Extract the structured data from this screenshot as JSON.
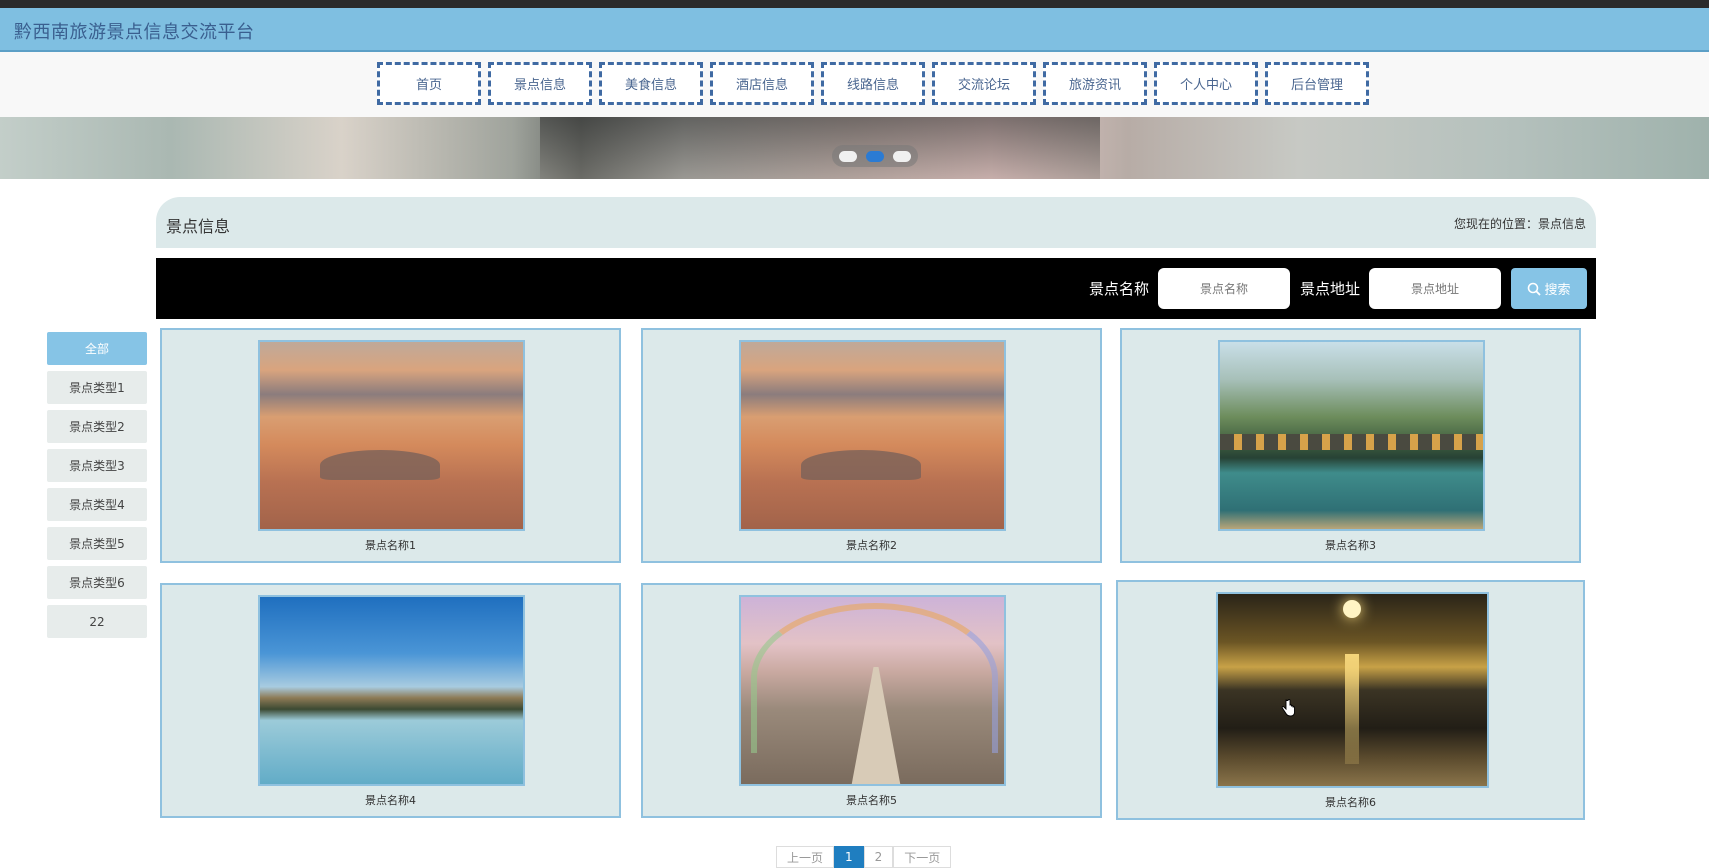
{
  "site": {
    "title": "黔西南旅游景点信息交流平台"
  },
  "nav": [
    {
      "label": "首页"
    },
    {
      "label": "景点信息"
    },
    {
      "label": "美食信息"
    },
    {
      "label": "酒店信息"
    },
    {
      "label": "线路信息"
    },
    {
      "label": "交流论坛"
    },
    {
      "label": "旅游资讯"
    },
    {
      "label": "个人中心"
    },
    {
      "label": "后台管理"
    }
  ],
  "banner": {
    "dot_count": 3,
    "active_dot": 2
  },
  "breadcrumb": {
    "title": "景点信息",
    "location_prefix": "您现在的位置：",
    "location_current": "景点信息"
  },
  "search": {
    "name_label": "景点名称",
    "name_placeholder": "景点名称",
    "address_label": "景点地址",
    "address_placeholder": "景点地址",
    "button_label": "搜索",
    "icon": "search-icon"
  },
  "sidebar": [
    {
      "label": "全部",
      "active": true
    },
    {
      "label": "景点类型1"
    },
    {
      "label": "景点类型2"
    },
    {
      "label": "景点类型3"
    },
    {
      "label": "景点类型4"
    },
    {
      "label": "景点类型5"
    },
    {
      "label": "景点类型6"
    },
    {
      "label": "22"
    }
  ],
  "cards": [
    {
      "caption": "景点名称1",
      "image": "sunset-clouds"
    },
    {
      "caption": "景点名称2",
      "image": "sunset-clouds"
    },
    {
      "caption": "景点名称3",
      "image": "river-bridge"
    },
    {
      "caption": "景点名称4",
      "image": "mountain-lake"
    },
    {
      "caption": "景点名称5",
      "image": "rainbow-path"
    },
    {
      "caption": "景点名称6",
      "image": "sea-sunset"
    }
  ],
  "pagination": {
    "prev": "上一页",
    "pages": [
      "1",
      "2"
    ],
    "current": "1",
    "next": "下一页"
  },
  "colors": {
    "title_bar": "#7fbfe1",
    "accent": "#86c4e6",
    "panel": "#dce9ea",
    "nav_border": "#3f6aa3",
    "page_active": "#1f7ec0"
  }
}
